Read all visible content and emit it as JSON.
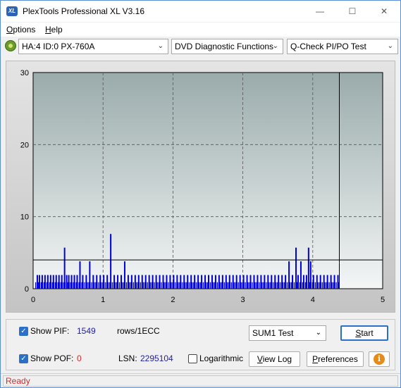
{
  "window": {
    "title": "PlexTools Professional XL V3.16",
    "app_icon_text": "XL",
    "minimize_glyph": "—",
    "maximize_glyph": "☐",
    "close_glyph": "✕"
  },
  "menu": {
    "options": {
      "first": "O",
      "rest": "ptions"
    },
    "help": {
      "first": "H",
      "rest": "elp"
    }
  },
  "toolbar": {
    "device": "HA:4 ID:0  PX-760A",
    "function": "DVD Diagnostic Functions",
    "test": "Q-Check PI/PO Test",
    "arrow": "⌄"
  },
  "chart_data": {
    "type": "bar",
    "y_ticks": [
      "30",
      "20",
      "10",
      "0"
    ],
    "x_ticks": [
      "0",
      "1",
      "2",
      "3",
      "4",
      "5"
    ],
    "ylim": [
      0,
      30
    ],
    "xlim": [
      0,
      5
    ],
    "grid": true,
    "threshold": 4,
    "end_marker_x": 4.38,
    "series": [
      {
        "color": "#0000e0",
        "x": [
          0.05,
          0.08,
          0.12,
          0.16,
          0.2,
          0.24,
          0.28,
          0.32,
          0.36,
          0.4,
          0.44,
          0.47,
          0.5,
          0.54,
          0.58,
          0.62,
          0.66,
          0.7,
          0.75,
          0.8,
          0.85,
          0.9,
          0.95,
          1.0,
          1.05,
          1.1,
          1.15,
          1.2,
          1.25,
          1.3,
          1.35,
          1.4,
          1.45,
          1.5,
          1.55,
          1.6,
          1.65,
          1.7,
          1.75,
          1.8,
          1.85,
          1.9,
          1.95,
          2.0,
          2.05,
          2.1,
          2.15,
          2.2,
          2.25,
          2.3,
          2.35,
          2.4,
          2.45,
          2.5,
          2.55,
          2.6,
          2.65,
          2.7,
          2.75,
          2.8,
          2.85,
          2.9,
          2.95,
          3.0,
          3.05,
          3.1,
          3.15,
          3.2,
          3.25,
          3.3,
          3.35,
          3.4,
          3.45,
          3.5,
          3.55,
          3.6,
          3.65,
          3.7,
          3.75,
          3.78,
          3.82,
          3.86,
          3.9,
          3.93,
          3.96,
          4.0,
          4.05,
          4.1,
          4.15,
          4.2,
          4.25,
          4.3,
          4.35
        ],
        "values": [
          1,
          1,
          1,
          1,
          1,
          1,
          1,
          1,
          1,
          1,
          3,
          1,
          1,
          1,
          1,
          1,
          2,
          1,
          1,
          2,
          1,
          1,
          1,
          1,
          1,
          4,
          1,
          1,
          1,
          2,
          1,
          1,
          1,
          1,
          1,
          1,
          1,
          1,
          1,
          1,
          1,
          1,
          1,
          1,
          1,
          1,
          1,
          1,
          1,
          1,
          1,
          1,
          1,
          1,
          1,
          1,
          1,
          1,
          1,
          1,
          1,
          1,
          1,
          1,
          1,
          1,
          1,
          1,
          1,
          1,
          1,
          1,
          1,
          1,
          1,
          1,
          2,
          1,
          3,
          1,
          2,
          1,
          1,
          3,
          2,
          1,
          1,
          1,
          1,
          1,
          1,
          1,
          1
        ]
      }
    ]
  },
  "bottom": {
    "show_pif_label": "Show PIF:",
    "pif_value": "1549",
    "rows_label": "rows/1ECC",
    "show_pof_label": "Show POF:",
    "pof_value": "0",
    "lsn_label": "LSN:",
    "lsn_value": "2295104",
    "logarithmic_label": "Logarithmic",
    "sum_test": "SUM1 Test",
    "start_first": "S",
    "start_rest": "tart",
    "viewlog_first": "V",
    "viewlog_rest": "iew Log",
    "prefs_first": "P",
    "prefs_rest": "references",
    "info_glyph": "i",
    "checkmark": "✓",
    "arrow": "⌄"
  },
  "status": {
    "text": "Ready"
  }
}
